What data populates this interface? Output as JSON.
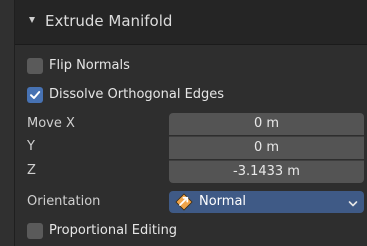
{
  "panel": {
    "title": "Extrude Manifold"
  },
  "options": {
    "flip_normals": {
      "label": "Flip Normals",
      "checked": false
    },
    "dissolve_orthogonal": {
      "label": "Dissolve Orthogonal Edges",
      "checked": true
    },
    "proportional_editing": {
      "label": "Proportional Editing",
      "checked": false
    }
  },
  "move": {
    "x_label": "Move X",
    "y_label": "Y",
    "z_label": "Z",
    "x_value": "0 m",
    "y_value": "0 m",
    "z_value": "-3.1433 m"
  },
  "orientation": {
    "label": "Orientation",
    "value": "Normal",
    "icon": "orientation-normal-icon"
  },
  "colors": {
    "accent": "#4772b3",
    "dropdown_bg": "#3f5a86",
    "field_bg": "#545454",
    "panel_bg": "#2e2e2e"
  }
}
